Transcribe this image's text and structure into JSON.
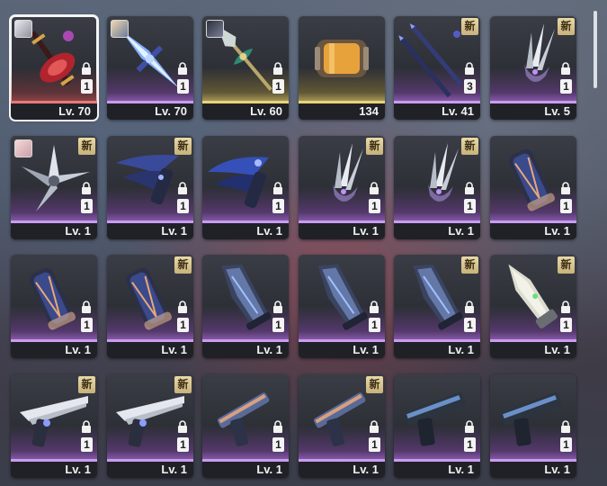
{
  "items": [
    {
      "footer": "Lv. 70",
      "rarity": "red",
      "art": "red-crimson-weapon",
      "icon": "crimson-sword-icon",
      "avatar": "a",
      "count": "1",
      "lock": true,
      "new": "",
      "selected": true
    },
    {
      "footer": "Lv. 70",
      "rarity": "purple",
      "art": "blue-crystal-lance",
      "icon": "crystal-lance-icon",
      "avatar": "b",
      "count": "1",
      "lock": true,
      "new": "",
      "selected": false
    },
    {
      "footer": "Lv. 60",
      "rarity": "gold",
      "art": "green-gold-spear",
      "icon": "ornate-spear-icon",
      "avatar": "c",
      "count": "1",
      "lock": true,
      "new": "",
      "selected": false
    },
    {
      "footer": "134",
      "rarity": "gold",
      "art": "capsule",
      "icon": "energy-capsule-icon",
      "avatar": "",
      "count": "",
      "lock": false,
      "new": "",
      "selected": false
    },
    {
      "footer": "Lv. 41",
      "rarity": "purple",
      "art": "dark-blades",
      "icon": "twin-blades-icon",
      "avatar": "",
      "count": "3",
      "lock": true,
      "new": "新",
      "selected": false
    },
    {
      "footer": "Lv. 5",
      "rarity": "purple",
      "art": "silver-claw",
      "icon": "silver-claw-icon",
      "avatar": "",
      "count": "1",
      "lock": true,
      "new": "新",
      "selected": false
    },
    {
      "footer": "Lv. 1",
      "rarity": "purple",
      "art": "shuriken",
      "icon": "star-blade-icon",
      "avatar": "d",
      "count": "1",
      "lock": true,
      "new": "新",
      "selected": false
    },
    {
      "footer": "Lv. 1",
      "rarity": "purple",
      "art": "dark-wing",
      "icon": "wing-blade-icon",
      "avatar": "",
      "count": "1",
      "lock": true,
      "new": "新",
      "selected": false
    },
    {
      "footer": "Lv. 1",
      "rarity": "purple",
      "art": "dark-wing-b",
      "icon": "wing-blade-icon",
      "avatar": "",
      "count": "1",
      "lock": true,
      "new": "",
      "selected": false
    },
    {
      "footer": "Lv. 1",
      "rarity": "purple",
      "art": "silver-claw",
      "icon": "silver-claw-icon",
      "avatar": "",
      "count": "1",
      "lock": true,
      "new": "新",
      "selected": false
    },
    {
      "footer": "Lv. 1",
      "rarity": "purple",
      "art": "silver-claw",
      "icon": "silver-claw-icon",
      "avatar": "",
      "count": "1",
      "lock": true,
      "new": "新",
      "selected": false
    },
    {
      "footer": "Lv. 1",
      "rarity": "purple",
      "art": "gauntlet",
      "icon": "gauntlet-icon",
      "avatar": "",
      "count": "1",
      "lock": true,
      "new": "",
      "selected": false
    },
    {
      "footer": "Lv. 1",
      "rarity": "purple",
      "art": "gauntlet",
      "icon": "gauntlet-icon",
      "avatar": "",
      "count": "1",
      "lock": true,
      "new": "",
      "selected": false
    },
    {
      "footer": "Lv. 1",
      "rarity": "purple",
      "art": "gauntlet",
      "icon": "gauntlet-icon",
      "avatar": "",
      "count": "1",
      "lock": true,
      "new": "新",
      "selected": false
    },
    {
      "footer": "Lv. 1",
      "rarity": "purple",
      "art": "blade-arm",
      "icon": "blade-arm-icon",
      "avatar": "",
      "count": "1",
      "lock": true,
      "new": "",
      "selected": false
    },
    {
      "footer": "Lv. 1",
      "rarity": "purple",
      "art": "blade-arm",
      "icon": "blade-arm-icon",
      "avatar": "",
      "count": "1",
      "lock": true,
      "new": "",
      "selected": false
    },
    {
      "footer": "Lv. 1",
      "rarity": "purple",
      "art": "blade-arm",
      "icon": "blade-arm-icon",
      "avatar": "",
      "count": "1",
      "lock": true,
      "new": "新",
      "selected": false
    },
    {
      "footer": "Lv. 1",
      "rarity": "purple",
      "art": "bone-blade",
      "icon": "bone-blade-icon",
      "avatar": "",
      "count": "1",
      "lock": true,
      "new": "新",
      "selected": false
    },
    {
      "footer": "Lv. 1",
      "rarity": "purple",
      "art": "gunblade",
      "icon": "gunblade-icon",
      "avatar": "",
      "count": "1",
      "lock": true,
      "new": "新",
      "selected": false
    },
    {
      "footer": "Lv. 1",
      "rarity": "purple",
      "art": "gunblade",
      "icon": "gunblade-icon",
      "avatar": "",
      "count": "1",
      "lock": true,
      "new": "新",
      "selected": false
    },
    {
      "footer": "Lv. 1",
      "rarity": "purple",
      "art": "pistol",
      "icon": "pistol-icon",
      "avatar": "",
      "count": "1",
      "lock": true,
      "new": "",
      "selected": false
    },
    {
      "footer": "Lv. 1",
      "rarity": "purple",
      "art": "pistol",
      "icon": "pistol-icon",
      "avatar": "",
      "count": "1",
      "lock": true,
      "new": "新",
      "selected": false
    },
    {
      "footer": "Lv. 1",
      "rarity": "purple",
      "art": "heavy-pistol",
      "icon": "heavy-pistol-icon",
      "avatar": "",
      "count": "1",
      "lock": true,
      "new": "",
      "selected": false
    },
    {
      "footer": "Lv. 1",
      "rarity": "purple",
      "art": "heavy-pistol",
      "icon": "heavy-pistol-icon",
      "avatar": "",
      "count": "1",
      "lock": true,
      "new": "",
      "selected": false
    }
  ]
}
